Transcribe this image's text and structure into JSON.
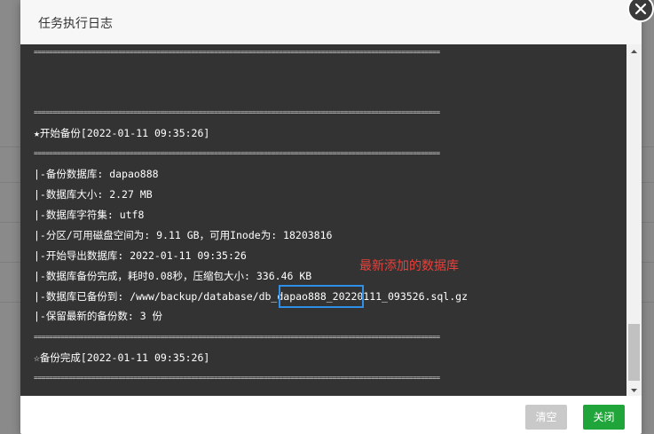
{
  "dialog": {
    "title": "任务执行日志",
    "buttons": {
      "clear": "清空",
      "close": "关闭"
    }
  },
  "log": {
    "separator": "==========================================================================================================",
    "start": "★开始备份[2022-01-11 09:35:26]",
    "lines": [
      "|-备份数据库: dapao888",
      "|-数据库大小: 2.27 MB",
      "|-数据库字符集: utf8",
      "|-分区/可用磁盘空间为: 9.11 GB，可用Inode为: 18203816",
      "|-开始导出数据库: 2022-01-11 09:35:26",
      "|-数据库备份完成，耗时0.08秒，压缩包大小: 336.46 KB",
      "|-数据库已备份到: /www/backup/database/db_dapao888_20220111_093526.sql.gz",
      "|-保留最新的备份数: 3 份"
    ],
    "end": "☆备份完成[2022-01-11 09:35:26]"
  },
  "annotation": {
    "text": "最新添加的数据库",
    "color": "#e8403a"
  },
  "colors": {
    "accent": "#20a53a",
    "log_bg": "#333333",
    "highlight": "#2f8fe6"
  },
  "icons": {
    "close": "close-icon",
    "scroll_up": "triangle-up-icon",
    "scroll_down": "triangle-down-icon"
  }
}
